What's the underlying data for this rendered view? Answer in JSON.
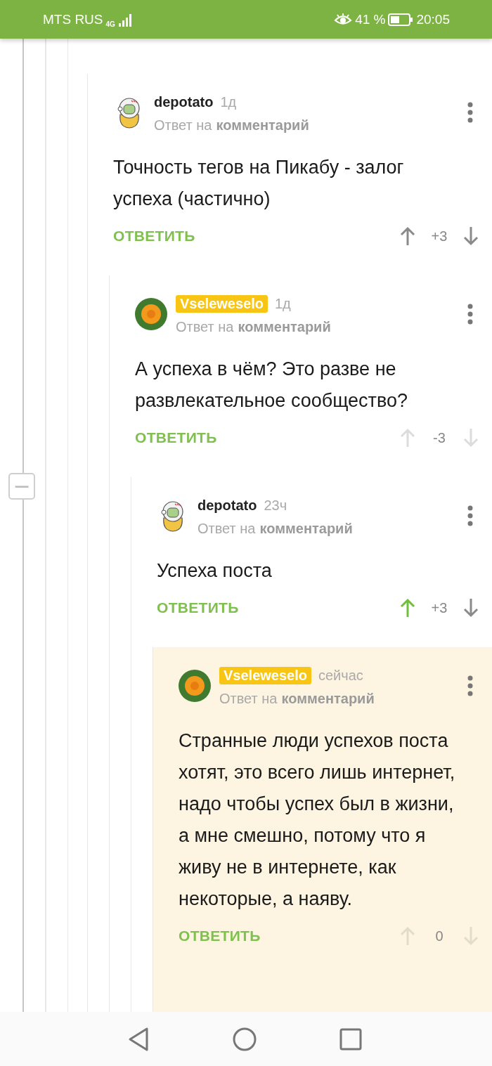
{
  "status_bar": {
    "carrier": "MTS RUS",
    "network": "4G",
    "battery": "41 %",
    "time": "20:05"
  },
  "collapse_button": {
    "label": "−"
  },
  "comments": [
    {
      "author": "depotato",
      "avatar": {
        "kind": "potato"
      },
      "op": false,
      "time": "1д",
      "reply_to_prefix": "Ответ на",
      "reply_to_link": "комментарий",
      "text": "Точность тегов на Пикабу - залог успеха (частично)",
      "reply": "ОТВЕТИТЬ",
      "score": "+3",
      "upvoted": false,
      "votes_faded": false,
      "highlighted": false,
      "children": [
        {
          "author": "Vseleweselo",
          "avatar": {
            "kind": "flower"
          },
          "op": true,
          "time": "1д",
          "reply_to_prefix": "Ответ на",
          "reply_to_link": "комментарий",
          "text": "А успеха в чём? Это разве не развлекательное сообщество?",
          "reply": "ОТВЕТИТЬ",
          "score": "-3",
          "upvoted": false,
          "votes_faded": true,
          "highlighted": false,
          "children": [
            {
              "author": "depotato",
              "avatar": {
                "kind": "potato"
              },
              "op": false,
              "time": "23ч",
              "reply_to_prefix": "Ответ на",
              "reply_to_link": "комментарий",
              "text": "Успеха поста",
              "reply": "ОТВЕТИТЬ",
              "score": "+3",
              "upvoted": true,
              "votes_faded": false,
              "highlighted": false,
              "children": [
                {
                  "author": "Vseleweselo",
                  "avatar": {
                    "kind": "flower"
                  },
                  "op": true,
                  "time": "сейчас",
                  "reply_to_prefix": "Ответ на",
                  "reply_to_link": "комментарий",
                  "text": "Странные люди успехов поста хотят, это всего лишь интернет, надо чтобы успех был в жизни, а мне смешно, потому что я живу не в интернете, как некоторые, а наяву.",
                  "reply": "ОТВЕТИТЬ",
                  "score": "0",
                  "upvoted": false,
                  "votes_faded": true,
                  "highlighted": true
                }
              ]
            }
          ]
        }
      ]
    }
  ]
}
